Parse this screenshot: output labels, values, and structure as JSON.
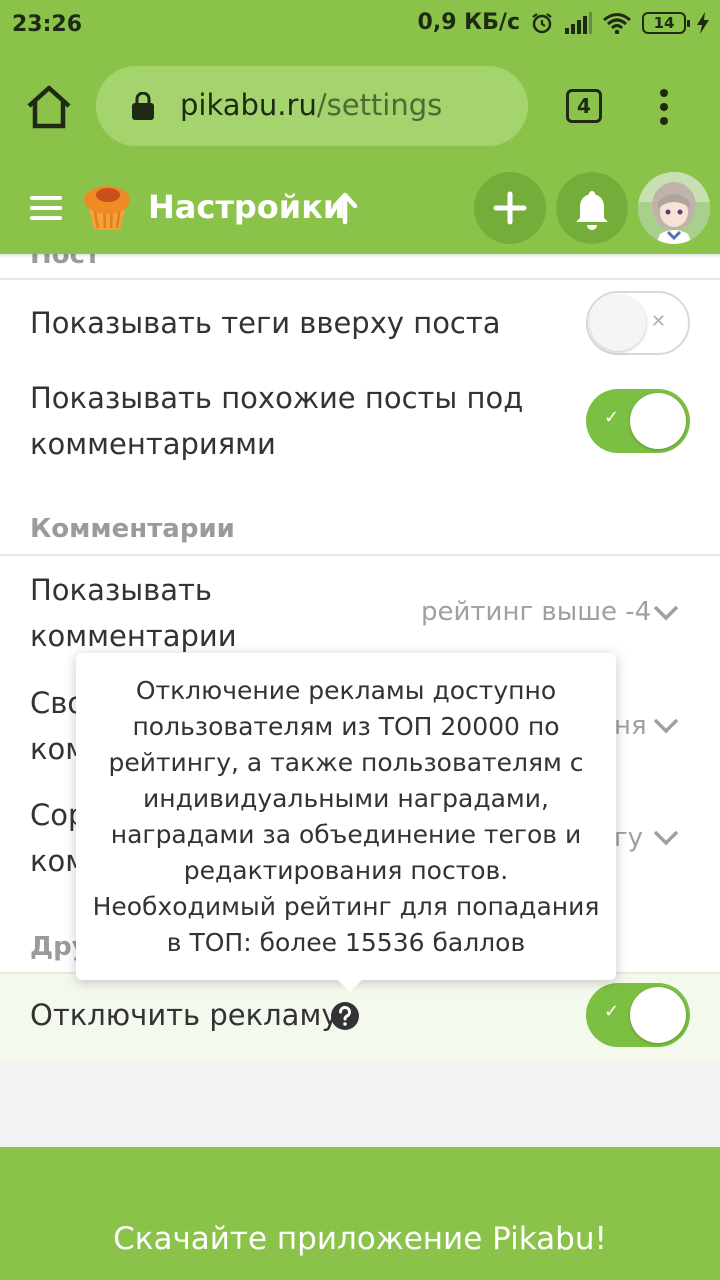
{
  "status_bar": {
    "time": "23:26",
    "net_speed": "0,9 КБ/с",
    "battery": "14",
    "icons": [
      "alarm-icon",
      "signal-icon",
      "wifi-icon",
      "battery-icon",
      "charging-icon"
    ]
  },
  "browser": {
    "url_host": "pikabu.ru",
    "url_path": "/settings",
    "tab_count": "4"
  },
  "header": {
    "title": "Настройки"
  },
  "settings": {
    "post_section_label": "Пост",
    "show_tags_label": "Показывать теги вверху поста",
    "show_tags_on": false,
    "similar_posts_line1": "Показывать похожие посты под",
    "similar_posts_line2": "комментариями",
    "similar_posts_on": true,
    "comments_section_label": "Комментарии",
    "show_comments_line1": "Показывать",
    "show_comments_line2": "комментарии",
    "show_comments_value": "рейтинг выше -4",
    "row2_line1": "Сво",
    "row2_line2": "ком",
    "row2_value_tail": "ня",
    "row3_line1": "Сор",
    "row3_line2": "ком",
    "row3_value_tail": "гу",
    "other_section_label": "Дру",
    "disable_ads_label": "Отключить рекламу",
    "disable_ads_on": true
  },
  "tooltip": {
    "lines": [
      "Отключение рекламы доступно",
      "пользователям из ТОП 20000 по",
      "рейтингу, а также пользователям с",
      "индивидуальными наградами,",
      "наградами за объединение тегов и",
      "редактирования постов.",
      "Необходимый рейтинг для попадания",
      "в ТОП: более 15536 баллов"
    ]
  },
  "footer": {
    "text": "Скачайте приложение Pikabu!"
  },
  "colors": {
    "brand_green": "#8bc34a",
    "toggle_on": "#7cc043",
    "section_gray": "#9b9b9b"
  }
}
